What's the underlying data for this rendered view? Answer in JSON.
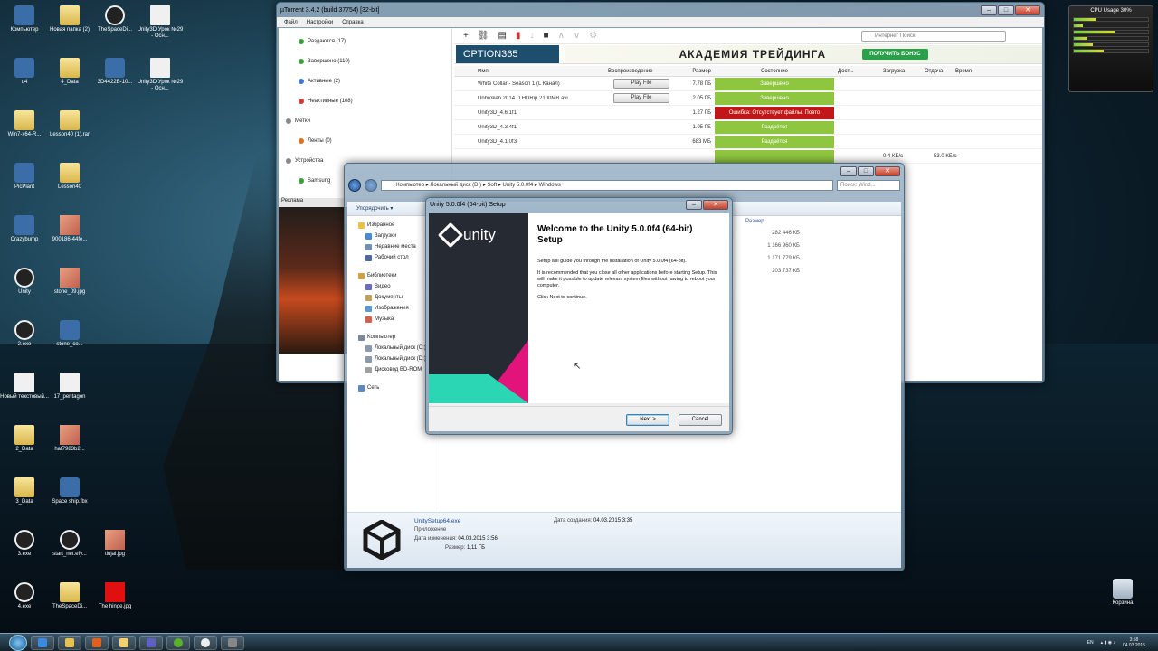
{
  "desktop": {
    "icons": [
      {
        "label": "Компьютер",
        "type": "app"
      },
      {
        "label": "Новая папка (2)",
        "type": "folder"
      },
      {
        "label": "TheSpaceDi...",
        "type": "unity"
      },
      {
        "label": "Unity3D Урок №29 - Осн...",
        "type": "file"
      },
      {
        "label": "u4",
        "type": "app"
      },
      {
        "label": "4_Data",
        "type": "folder"
      },
      {
        "label": "3D4422B-10...",
        "type": "app"
      },
      {
        "label": "Unity3D Урок №29 - Осн...",
        "type": "file"
      },
      {
        "label": "Win7-x64-R...",
        "type": "folder"
      },
      {
        "label": "Lesson40 (1).rar",
        "type": "folder"
      },
      {
        "label": "PicPlant",
        "type": "app"
      },
      {
        "label": "Lesson40",
        "type": "folder"
      },
      {
        "label": "Crazybump",
        "type": "app"
      },
      {
        "label": "900186-44fe...",
        "type": "img"
      },
      {
        "label": "Unity",
        "type": "unity"
      },
      {
        "label": "stone_09.jpg",
        "type": "img"
      },
      {
        "label": "2.exe",
        "type": "unity"
      },
      {
        "label": "stone_co...",
        "type": "app"
      },
      {
        "label": "Новый текстовый...",
        "type": "file"
      },
      {
        "label": "17_pentagon",
        "type": "file"
      },
      {
        "label": "2_Data",
        "type": "folder"
      },
      {
        "label": "hat7983b2...",
        "type": "img"
      },
      {
        "label": "3_Data",
        "type": "folder"
      },
      {
        "label": "Space ship.fbx",
        "type": "app"
      },
      {
        "label": "3.exe",
        "type": "unity"
      },
      {
        "label": "start_net.efy...",
        "type": "unity"
      },
      {
        "label": "tiujai.jpg",
        "type": "img"
      },
      {
        "label": "4.exe",
        "type": "unity"
      },
      {
        "label": "TheSpaceDi...",
        "type": "folder"
      },
      {
        "label": "The hinge.jpg",
        "type": "red"
      },
      {
        "label": "Корзина",
        "type": "trash"
      }
    ]
  },
  "gadget": {
    "title": "CPU Usage 30%",
    "cores": [
      0.3,
      0.12,
      0.55,
      0.18,
      0.25,
      0.4
    ]
  },
  "utorrent": {
    "title": "µTorrent 3.4.2 (build 37754) [32-bit]",
    "menu": [
      "Файл",
      "Настройки",
      "Справка"
    ],
    "sidebar": [
      {
        "label": "Раздаются (17)",
        "color": "#3aa03a"
      },
      {
        "label": "Завершено (110)",
        "color": "#3aa03a"
      },
      {
        "label": "Активные (2)",
        "color": "#3a7ad0"
      },
      {
        "label": "Неактивные (108)",
        "color": "#d03a3a"
      },
      {
        "label": "Метки",
        "color": "#888888"
      },
      {
        "label": "Ленты (0)",
        "color": "#e07020"
      },
      {
        "label": "Устройства",
        "color": "#888888"
      },
      {
        "label": "Samsung",
        "color": "#3aa03a"
      }
    ],
    "ad_band": "Реклама",
    "search_placeholder": "Интернет Поиск",
    "banner": {
      "brand": "OPTION365",
      "headline": "АКАДЕМИЯ ТРЕЙДИНГА",
      "cta": "ПОЛУЧИТЬ БОНУС"
    },
    "columns": [
      "Имя",
      "Воспроизведение",
      "Размер",
      "Состояние",
      "Дост...",
      "Загрузка",
      "Отдача",
      "Время"
    ],
    "rows": [
      {
        "name": "White Collar - Season 1 (L Канал)",
        "play": "Play File",
        "size": "7.78 ГБ",
        "state": "Завершено",
        "state_color": "#8ec63f"
      },
      {
        "name": "Unbroken.2014.D.HDRip.2100MB.avi",
        "play": "Play File",
        "size": "2.05 ГБ",
        "state": "Завершено",
        "state_color": "#8ec63f"
      },
      {
        "name": "Unity3D_4.6.1f1",
        "play": "",
        "size": "1.27 ГБ",
        "state": "Ошибка: Отсутствует файлы. Повто",
        "state_color": "#c01818"
      },
      {
        "name": "Unity3D_4.3.4f1",
        "play": "",
        "size": "1.05 ГБ",
        "state": "Раздаётся",
        "state_color": "#8ec63f"
      },
      {
        "name": "Unity3D_4.1.0f3",
        "play": "",
        "size": "683 МБ",
        "state": "Раздаётся",
        "state_color": "#8ec63f"
      },
      {
        "name": "",
        "play": "",
        "size": "",
        "state": "",
        "state_color": "#8ec63f",
        "down": "0.4 КБ/с",
        "up": "53.0 КБ/с"
      }
    ]
  },
  "explorer": {
    "address": "Компьютер ▸ Локальный диск (D:) ▸ Soft ▸ Unity 5.0.0f4 ▸ Windows",
    "search": "Поиск: Wind...",
    "organize": "Упорядочить ▾",
    "nav": [
      {
        "label": "Избранное",
        "indent": 0
      },
      {
        "label": "Загрузки",
        "indent": 1
      },
      {
        "label": "Недавние места",
        "indent": 1
      },
      {
        "label": "Рабочий стол",
        "indent": 1
      },
      {
        "label": "Библиотеки",
        "indent": 0
      },
      {
        "label": "Видео",
        "indent": 1
      },
      {
        "label": "Документы",
        "indent": 1
      },
      {
        "label": "Изображения",
        "indent": 1
      },
      {
        "label": "Музыка",
        "indent": 1
      },
      {
        "label": "Компьютер",
        "indent": 0
      },
      {
        "label": "Локальный диск (C:)",
        "indent": 1
      },
      {
        "label": "Локальный диск (D:)",
        "indent": 1
      },
      {
        "label": "Дисковод BD-ROM",
        "indent": 1
      },
      {
        "label": "Сеть",
        "indent": 0
      }
    ],
    "size_header": "Размер",
    "sizes": [
      "282 446 КБ",
      "1 166 960 КБ",
      "1 171 779 КБ",
      "203 737 КБ"
    ],
    "details": {
      "filename": "UnitySetup64.exe",
      "type": "Приложение",
      "modified_label": "Дата изменения:",
      "modified": "04.03.2015 3:56",
      "size_label": "Размер:",
      "size": "1,11 ГБ",
      "created_label": "Дата создания:",
      "created": "04.03.2015 3:35"
    }
  },
  "setup": {
    "title": "Unity 5.0.0f4 (64-bit) Setup",
    "logo_text": "unity",
    "heading": "Welcome to the Unity 5.0.0f4 (64-bit) Setup",
    "p1": "Setup will guide you through the installation of Unity 5.0.0f4 (64-bit).",
    "p2": "It is recommended that you close all other applications before starting Setup. This will make it possible to update relevant system files without having to reboot your computer.",
    "p3": "Click Next to continue.",
    "next": "Next >",
    "cancel": "Cancel"
  },
  "taskbar": {
    "lang": "EN",
    "time": "3:58",
    "date": "04.03.2015"
  }
}
